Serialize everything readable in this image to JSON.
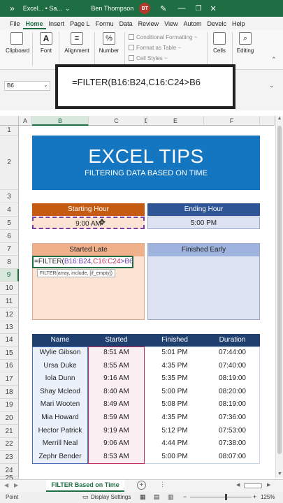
{
  "window": {
    "menu_glyph": "»",
    "title": "Excel... • Sa...",
    "user": "Ben Thompson",
    "initials": "BT"
  },
  "ribbon_tabs": [
    "File",
    "Home",
    "Insert",
    "Page L",
    "Formu",
    "Data",
    "Review",
    "View",
    "Autom",
    "Develc",
    "Help"
  ],
  "ribbon": {
    "clipboard": "Clipboard",
    "font": "Font",
    "alignment": "Alignment",
    "number": "Number",
    "conditional_formatting": "Conditional Formatting ~",
    "format_as_table": "Format as Table ~",
    "cell_styles": "Cell Styles ~",
    "cells": "Cells",
    "editing": "Editing"
  },
  "name_box": "B6",
  "formula_overlay": "=FILTER(B16:B24,C16:C24>B6",
  "columns": [
    "A",
    "B",
    "C",
    "D",
    "E",
    "F"
  ],
  "rows": [
    "1",
    "2",
    "3",
    "4",
    "5",
    "6",
    "7",
    "8",
    "9",
    "10",
    "11",
    "12",
    "13",
    "14",
    "15",
    "16",
    "17",
    "18",
    "19",
    "20",
    "21",
    "22",
    "23",
    "24",
    "25"
  ],
  "banner": {
    "title": "EXCEL TIPS",
    "subtitle": "FILTERING DATA BASED ON TIME"
  },
  "starting_hour": {
    "label": "Starting Hour",
    "value": "9:00 AM"
  },
  "ending_hour": {
    "label": "Ending Hour",
    "value": "5:00 PM"
  },
  "started_late": "Started Late",
  "finished_early": "Finished Early",
  "cell_edit": {
    "prefix": "=FILTER(",
    "ref1": "B16:B24",
    "comma": ",",
    "ref2": "C16:C24",
    "ref3": ">B6",
    "close": ")",
    "tooltip": "FILTER(array, include, [if_empty])"
  },
  "table": {
    "headers": [
      "Name",
      "Started",
      "Finished",
      "Duration"
    ],
    "rows": [
      [
        "Wylie Gibson",
        "8:51 AM",
        "5:01 PM",
        "07:44:00"
      ],
      [
        "Ursa Duke",
        "8:55 AM",
        "4:35 PM",
        "07:40:00"
      ],
      [
        "Iola Dunn",
        "9:16 AM",
        "5:35 PM",
        "08:19:00"
      ],
      [
        "Shay Mcleod",
        "8:40 AM",
        "5:00 PM",
        "08:20:00"
      ],
      [
        "Mari Wooten",
        "8:49 AM",
        "5:08 PM",
        "08:19:00"
      ],
      [
        "Mia Howard",
        "8:59 AM",
        "4:35 PM",
        "07:36:00"
      ],
      [
        "Hector Patrick",
        "9:19 AM",
        "5:12 PM",
        "07:53:00"
      ],
      [
        "Merrill Neal",
        "9:06 AM",
        "4:44 PM",
        "07:38:00"
      ],
      [
        "Zephr Bender",
        "8:53 AM",
        "5:00 PM",
        "08:07:00"
      ]
    ]
  },
  "sheet_tab": "FILTER Based on Time",
  "status": {
    "mode": "Point",
    "display_settings": "Display Settings",
    "zoom": "125%"
  },
  "colors": {
    "excel_green": "#1f6e43",
    "banner_blue": "#1476c0",
    "orange_header": "#c55a11",
    "blue_header": "#2f5597",
    "table_header": "#1f3f6e"
  }
}
